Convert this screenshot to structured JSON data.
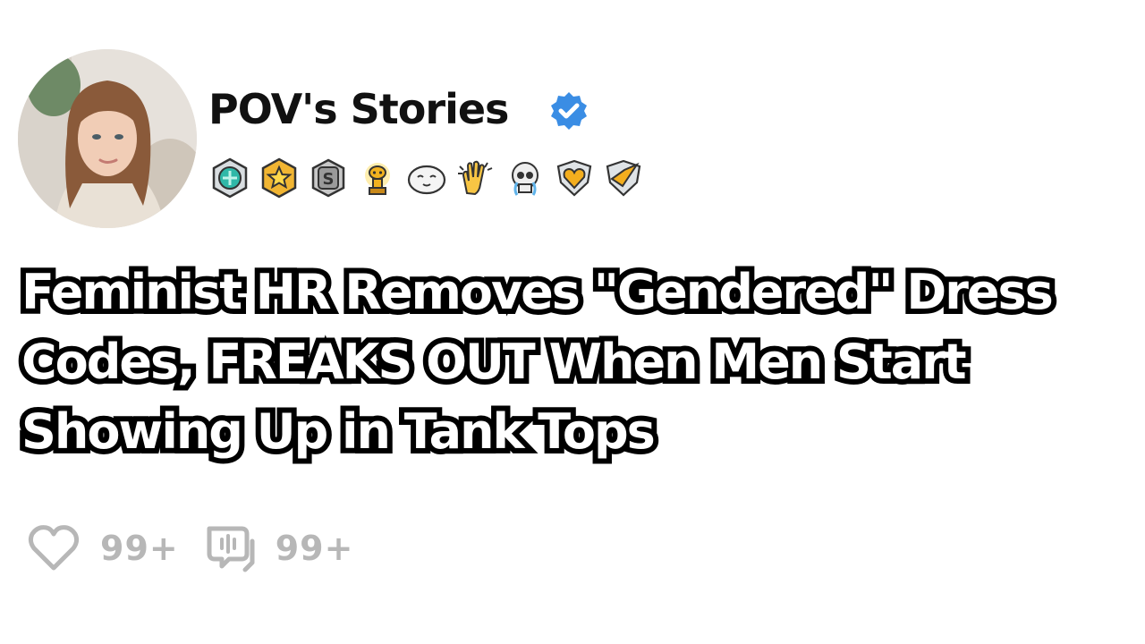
{
  "author": {
    "name": "POV's Stories",
    "verified": true,
    "verified_color": "#3a8de4",
    "avatar": "woman-portrait-photo"
  },
  "badges": [
    {
      "icon": "teal-gem-badge-icon"
    },
    {
      "icon": "gold-star-badge-icon"
    },
    {
      "icon": "silver-s-badge-icon"
    },
    {
      "icon": "gold-trophy-snoo-icon"
    },
    {
      "icon": "sleepy-face-icon"
    },
    {
      "icon": "clapping-hands-icon"
    },
    {
      "icon": "crying-skull-icon"
    },
    {
      "icon": "gold-heart-shield-icon"
    },
    {
      "icon": "gold-wing-shield-icon"
    }
  ],
  "post": {
    "title_lines": [
      "Feminist HR Removes \"Gendered\" Dress",
      "Codes, FREAKS OUT When Men Start",
      "Showing Up in Tank Tops"
    ]
  },
  "stats": {
    "likes": "99+",
    "comments": "99+"
  },
  "colors": {
    "stat_gray": "#b7b7b7",
    "title_stroke": "#000000",
    "title_fill": "#ffffff"
  }
}
